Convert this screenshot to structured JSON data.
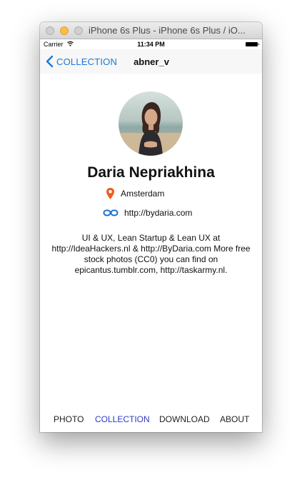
{
  "window": {
    "title": "iPhone 6s Plus - iPhone 6s Plus / iO..."
  },
  "status_bar": {
    "carrier": "Carrier",
    "time": "11:34 PM"
  },
  "nav": {
    "back_label": "COLLECTION",
    "title": "abner_v"
  },
  "profile": {
    "name": "Daria Nepriakhina",
    "location": "Amsterdam",
    "website": "http://bydaria.com",
    "bio": "UI & UX, Lean Startup & Lean UX at http://IdeaHackers.nl & http://ByDaria.com More free stock photos (CC0) you can find on epicantus.tumblr.com, http://taskarmy.nl."
  },
  "tabs": {
    "photo": "PHOTO",
    "collection": "COLLECTION",
    "download": "DOWNLOAD",
    "about": "ABOUT",
    "active": "collection"
  },
  "colors": {
    "accent": "#1a78d8",
    "active_tab": "#2d38c9",
    "location_icon": "#f25a1c",
    "link_icon": "#1a6fd0"
  },
  "icons": {
    "back": "chevron-left-icon",
    "location": "location-pin-icon",
    "website": "link-icon",
    "wifi": "wifi-icon",
    "battery": "battery-icon"
  }
}
